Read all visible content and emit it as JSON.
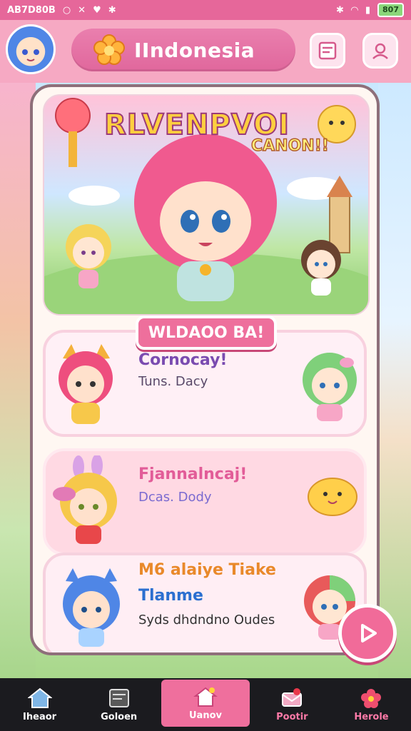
{
  "status_bar": {
    "left_text": "AB7D80B",
    "battery": "807"
  },
  "header": {
    "title": "IIndonesia",
    "icons": [
      "avatar",
      "flower-icon",
      "document-icon",
      "profile-icon"
    ]
  },
  "hero": {
    "title": "RLVENPVOI",
    "subtitle": "CANON!!"
  },
  "banner": {
    "label": "WLDAOO BA!"
  },
  "rows": [
    {
      "title": "Cornocay!",
      "subtitle": "Tuns. Dacy",
      "title_color": "#7a4bb0",
      "sub_color": "#5a4a6a"
    },
    {
      "title": "Fjannalncaj!",
      "subtitle": "Dcas. Dody",
      "title_color": "#e25c98",
      "sub_color": "#7a6ad0"
    },
    {
      "title": "M6 alaiye Tiake",
      "heading2": "Tlanme",
      "subtitle": "Syds dhdndno Oudes",
      "title_color": "#e9892a",
      "sub_color": "#333333"
    }
  ],
  "bottom_nav": [
    {
      "label": "Iheaor",
      "icon": "home-icon"
    },
    {
      "label": "Goloen",
      "icon": "board-icon"
    },
    {
      "label": "Uanov",
      "icon": "house-heart-icon"
    },
    {
      "label": "Pootir",
      "icon": "mail-heart-icon"
    },
    {
      "label": "Herole",
      "icon": "flower-icon"
    }
  ],
  "colors": {
    "accent": "#ef6f9d",
    "header_bg": "#f6a9c3",
    "nav_bg": "#1b1b1f"
  }
}
